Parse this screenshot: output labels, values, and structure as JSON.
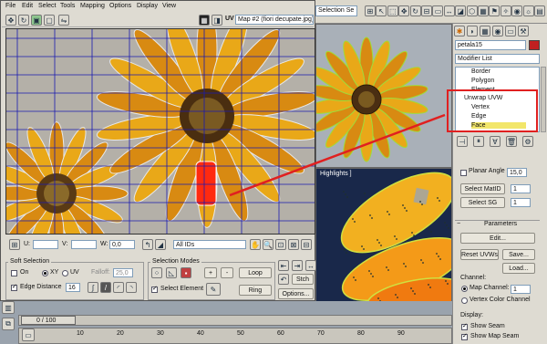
{
  "uvw_editor": {
    "menu": [
      "File",
      "Edit",
      "Select",
      "Tools",
      "Mapping",
      "Options",
      "Display",
      "View"
    ],
    "uv_label": "UV",
    "map_dropdown": "Map #2 (fiori decupate.jpg)",
    "coords": {
      "u_label": "U:",
      "v_label": "V:",
      "w_label": "W:",
      "w_value": "0,0"
    },
    "ids_dropdown": "All IDs"
  },
  "soft_selection": {
    "title": "Soft Selection",
    "on_label": "On",
    "xy_label": "XY",
    "uv_label": "UV",
    "falloff_label": "Falloff:",
    "falloff_value": "25,0",
    "edge_distance_label": "Edge Distance",
    "edge_distance_value": "16"
  },
  "selection_modes": {
    "title": "Selection Modes",
    "plus": "+",
    "minus": "-",
    "select_element_label": "Select Element",
    "loop": "Loop",
    "ring": "Ring"
  },
  "sticky_panel": {
    "stitch": "Stch",
    "options": "Options..."
  },
  "viewport": {
    "selection_dropdown": "Selection Se",
    "highlights_label": "Highlights ]"
  },
  "command_panel": {
    "object_name": "petala15",
    "modifier_list": "Modifier List",
    "stack": [
      {
        "label": "Border",
        "selected": false
      },
      {
        "label": "Polygon",
        "selected": false
      },
      {
        "label": "Element",
        "selected": false
      },
      {
        "label": "Unwrap UVW",
        "selected": false
      },
      {
        "label": "Vertex",
        "selected": false
      },
      {
        "label": "Edge",
        "selected": false
      },
      {
        "label": "Face",
        "selected": true
      }
    ],
    "planar_angle_label": "Planar Angle",
    "planar_angle_value": "15,0",
    "select_matid": "Select MatID",
    "select_matid_value": "1",
    "select_sg": "Select SG",
    "select_sg_value": "1",
    "parameters_title": "Parameters",
    "edit": "Edit...",
    "reset_uvws": "Reset UVWs",
    "save": "Save...",
    "load": "Load...",
    "channel_title": "Channel:",
    "map_channel_label": "Map Channel:",
    "map_channel_value": "1",
    "vertex_color_channel": "Vertex Color Channel",
    "display_title": "Display:",
    "show_seam": "Show Seam",
    "show_map_seam": "Show Map Seam"
  },
  "timeline": {
    "frame_counter": "0 / 100",
    "ticks": [
      "10",
      "20",
      "30",
      "40",
      "50",
      "60",
      "70",
      "80",
      "90"
    ]
  },
  "colors": {
    "selection_highlight": "#ff2020",
    "uv_grid": "#1a1ab0",
    "wire": "#e8e8e8"
  }
}
